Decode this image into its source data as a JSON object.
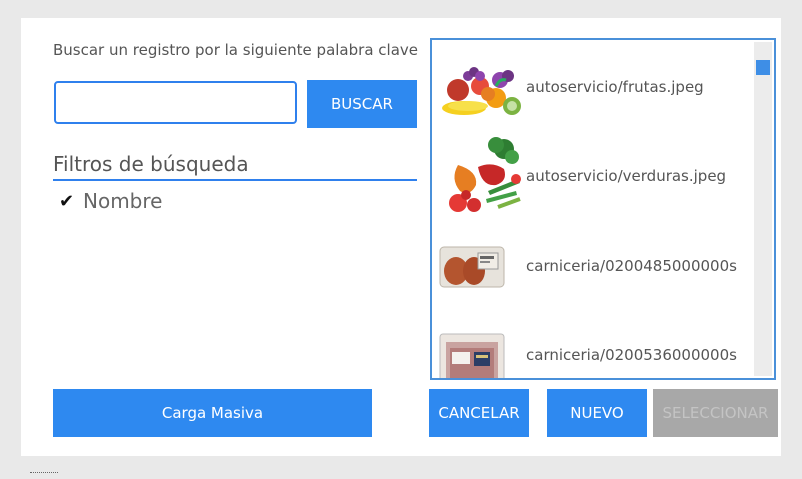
{
  "dialog": {
    "prompt": "Buscar un registro por la siguiente palabra clave",
    "search": {
      "value": "",
      "placeholder": ""
    },
    "search_button": "BUSCAR",
    "filters": {
      "title": "Filtros de búsqueda",
      "items": [
        {
          "label": "Nombre",
          "checked": true
        }
      ]
    },
    "results": [
      {
        "label": "autoservicio/frutas.jpeg",
        "icon": "fruits-image"
      },
      {
        "label": "autoservicio/verduras.jpeg",
        "icon": "vegetables-image"
      },
      {
        "label": "carniceria/0200485000000s",
        "icon": "sausage-package-image"
      },
      {
        "label": "carniceria/0200536000000s",
        "icon": "meat-package-image"
      }
    ],
    "buttons": {
      "bulk_load": "Carga Masiva",
      "cancel": "CANCELAR",
      "new": "NUEVO",
      "select": "SELECCIONAR"
    }
  },
  "colors": {
    "accent": "#2e89f0",
    "disabled": "#a8a8a8",
    "background": "#e9e9e9"
  }
}
